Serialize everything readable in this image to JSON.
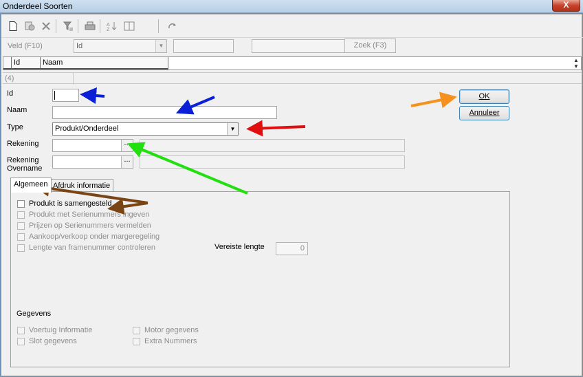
{
  "window": {
    "title": "Onderdeel Soorten",
    "close_glyph": "X"
  },
  "toolbar": {
    "icons": [
      "new-icon",
      "copy-icon",
      "delete-icon",
      "clear-filter-icon",
      "print-icon",
      "sort-icon",
      "columns-icon",
      "redo-icon"
    ]
  },
  "findbar": {
    "field_label": "Veld (F10)",
    "field_value": "Id",
    "search_value": "",
    "search_button": "Zoek (F3)"
  },
  "grid": {
    "columns": [
      "Id",
      "Naam"
    ],
    "record_count": "(4)"
  },
  "form": {
    "id_label": "Id",
    "id_value": "",
    "naam_label": "Naam",
    "naam_value": "",
    "type_label": "Type",
    "type_value": "Produkt/Onderdeel",
    "rekening_label": "Rekening",
    "rekening_overname_label": "Rekening Overname",
    "ellipsis": "..."
  },
  "buttons": {
    "ok": "OK",
    "cancel": "Annuleer"
  },
  "tabs": [
    "Algemeen",
    "Afdruk informatie"
  ],
  "algemeen": {
    "checkboxes": [
      {
        "label": "Produkt is samengesteld",
        "enabled": true,
        "checked": false
      },
      {
        "label": "Produkt met Serienummers ingeven",
        "enabled": false,
        "checked": false
      },
      {
        "label": "Prijzen op Serienummers vermelden",
        "enabled": false,
        "checked": false
      },
      {
        "label": "Aankoop/verkoop onder margeregeling",
        "enabled": false,
        "checked": false
      },
      {
        "label": "Lengte van framenummer controleren",
        "enabled": false,
        "checked": false
      }
    ],
    "required_length_label": "Vereiste lengte",
    "required_length_value": "0",
    "gegevens_heading": "Gegevens",
    "gegevens": [
      {
        "label": "Voertuig Informatie",
        "enabled": false
      },
      {
        "label": "Motor gegevens",
        "enabled": false
      },
      {
        "label": "Slot gegevens",
        "enabled": false
      },
      {
        "label": "Extra Nummers",
        "enabled": false
      }
    ]
  },
  "annotation_colors": {
    "blue": "#0a1fd6",
    "red": "#e01010",
    "green": "#22e010",
    "orange": "#f5921e",
    "brown": "#7a4514"
  }
}
